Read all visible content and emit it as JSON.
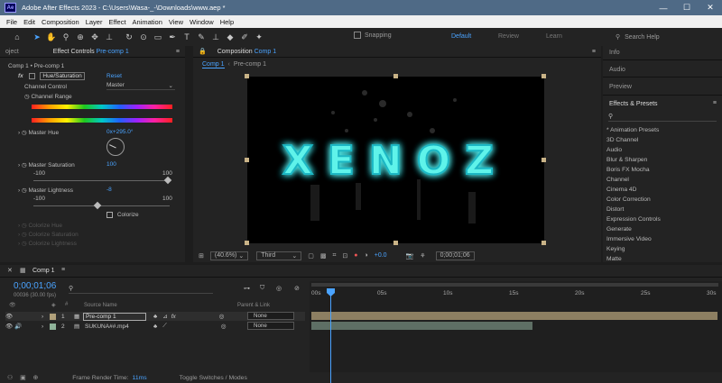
{
  "titlebar": {
    "logo": "Ae",
    "title": "Adobe After Effects 2023 - C:\\Users\\Wasa-_-\\Downloads\\www.aep *"
  },
  "menu": [
    "File",
    "Edit",
    "Composition",
    "Layer",
    "Effect",
    "Animation",
    "View",
    "Window",
    "Help"
  ],
  "toolbar": {
    "snapping": "Snapping",
    "workspaces": [
      "Default",
      "Review",
      "Learn"
    ],
    "search_placeholder": "Search Help"
  },
  "effect_controls": {
    "tab_left": "oject",
    "tab_label": "Effect Controls",
    "tab_layer": "Pre-comp 1",
    "breadcrumb": "Comp 1 • Pre-comp 1",
    "effect_name": "Hue/Saturation",
    "reset": "Reset",
    "channel_control_label": "Channel Control",
    "channel_control_value": "Master",
    "channel_range_label": "Channel Range",
    "master_hue_label": "Master Hue",
    "master_hue_value": "0x+295.0°",
    "master_saturation_label": "Master Saturation",
    "master_saturation_value": "100",
    "sat_min": "-100",
    "sat_max": "100",
    "master_lightness_label": "Master Lightness",
    "master_lightness_value": "-8",
    "light_min": "-100",
    "light_max": "100",
    "colorize_label": "Colorize",
    "colorize_hue": "Colorize Hue",
    "colorize_saturation": "Colorize Saturation",
    "colorize_lightness": "Colorize Lightness"
  },
  "composition": {
    "tab_label": "Composition",
    "tab_comp": "Comp 1",
    "viewer_tabs": [
      "Comp 1",
      "Pre-comp 1"
    ],
    "artwork_text": "XENOZ",
    "zoom": "(40.6%)",
    "resolution": "Third",
    "exposure": "+0.0",
    "timecode": "0;00;01;06"
  },
  "right_panel": {
    "info": "Info",
    "audio": "Audio",
    "preview": "Preview",
    "effects_title": "Effects & Presets",
    "effects": [
      "* Animation Presets",
      "3D Channel",
      "Audio",
      "Blur & Sharpen",
      "Boris FX Mocha",
      "Channel",
      "Cinema 4D",
      "Color Correction",
      "Distort",
      "Expression Controls",
      "Generate",
      "Immersive Video",
      "Keying",
      "Matte"
    ]
  },
  "timeline": {
    "tab": "Comp 1",
    "timecode": "0;00;01;06",
    "frame_info": "00036 (30.00 fps)",
    "columns": {
      "source_name": "Source Name",
      "parent_link": "Parent & Link"
    },
    "layers": [
      {
        "num": "1",
        "name": "Pre-comp 1",
        "parent": "None",
        "color": "#b0a07a"
      },
      {
        "num": "2",
        "name": "SUKUNA##.mp4",
        "parent": "None",
        "color": "#8fb39a"
      }
    ],
    "ruler": [
      "00s",
      "05s",
      "10s",
      "15s",
      "20s",
      "25s",
      "30s"
    ],
    "frame_render_label": "Frame Render Time:",
    "frame_render_value": "11ms",
    "toggle_label": "Toggle Switches / Modes"
  },
  "colors": {
    "accent": "#4aa3ff",
    "titlebar": "#4f6a86",
    "glow_text": "#40e0d8",
    "layer1_bar": "#8d7f62",
    "layer2_bar": "#5e6f65"
  }
}
